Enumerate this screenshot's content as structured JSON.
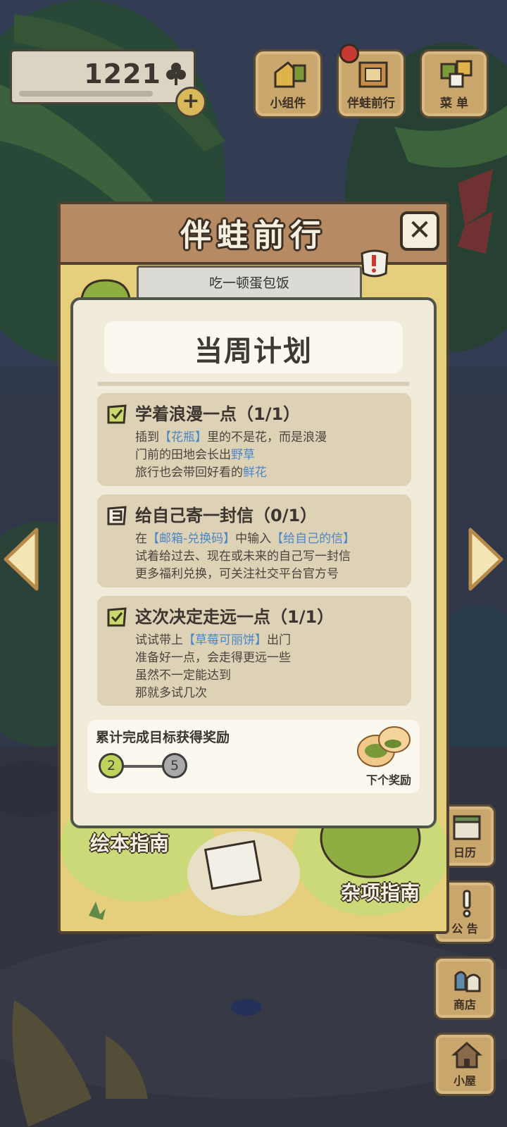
{
  "hud": {
    "clover_count": "1221",
    "plus_label": "+"
  },
  "top_buttons": [
    {
      "label": "小组件",
      "icon": "widget-icon"
    },
    {
      "label": "伴蛙前行",
      "icon": "journey-book-icon"
    },
    {
      "label": "菜 单",
      "icon": "menu-icon"
    }
  ],
  "side_buttons": [
    {
      "label": "日历",
      "icon": "calendar-icon"
    },
    {
      "label": "公 告",
      "icon": "notice-icon"
    },
    {
      "label": "商店",
      "icon": "shop-icon"
    },
    {
      "label": "小屋",
      "icon": "house-icon"
    }
  ],
  "panel": {
    "title": "伴蛙前行",
    "close_label": "✕",
    "sign_text": "吃一顿蛋包饭",
    "card_left": "绘本指南",
    "card_right": "杂项指南"
  },
  "plan": {
    "title": "当周计划",
    "tasks": [
      {
        "title": "学着浪漫一点（1/1）",
        "status": "done",
        "l1a": "插到",
        "l1b": "【花瓶】",
        "l1c": "里的不是花，而是浪漫",
        "l2a": "门前的田地会长出",
        "l2b": "野草",
        "l3a": "旅行也会带回好看的",
        "l3b": "鲜花"
      },
      {
        "title": "给自己寄一封信（0/1）",
        "status": "pending",
        "l1a": "在",
        "l1b": "【邮箱-兑换码】",
        "l1c": "中输入",
        "l1d": "【给自己的信】",
        "l2": "试着给过去、现在或未来的自己写一封信",
        "l3": "更多福利兑换，可关注社交平台官方号"
      },
      {
        "title": "这次决定走远一点（1/1）",
        "status": "done",
        "l1a": "试试带上",
        "l1b": "【草莓可丽饼】",
        "l1c": "出门",
        "l2": "准备好一点，会走得更远一些",
        "l3": "虽然不一定能达到",
        "l4": "那就多试几次"
      }
    ],
    "reward": {
      "title": "累计完成目标获得奖励",
      "completed": "2",
      "next_target": "5",
      "next_label": "下个奖励"
    }
  },
  "colors": {
    "highlight": "#4a88c8",
    "panel_bg": "#e6cf7c",
    "header_bg": "#b68a63",
    "progress_done": "#bfd35a"
  }
}
